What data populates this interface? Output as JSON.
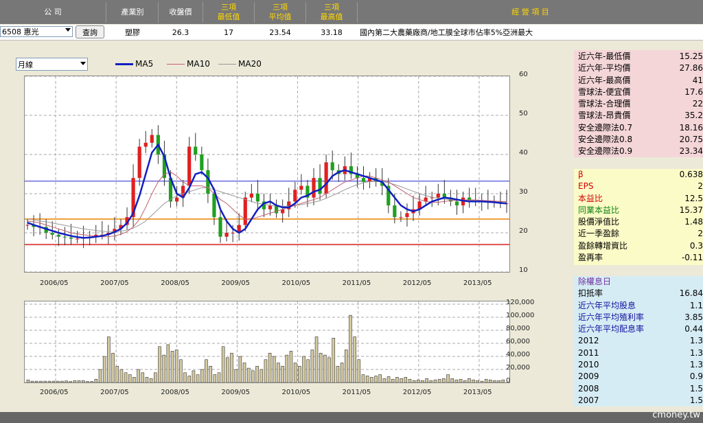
{
  "header": {
    "company": "公 司",
    "industry": "產業別",
    "close": "收盤價",
    "min3": [
      "三項",
      "最低值"
    ],
    "avg3": [
      "三項",
      "平均值"
    ],
    "max3": [
      "三項",
      "最高值"
    ],
    "business": "經 營 項 目"
  },
  "row": {
    "stock_code": "6508",
    "stock_name": "惠光",
    "query_button": "查詢",
    "industry": "塑膠",
    "close": "26.3",
    "min3": "17",
    "avg3": "23.54",
    "max3": "33.18",
    "business": "國內第二大農藥廠商/地工膜全球市佔率5%亞洲最大"
  },
  "period_select": "月線",
  "legend": [
    {
      "name": "MA5",
      "color": "#1020c0"
    },
    {
      "name": "MA10",
      "color": "#c06070"
    },
    {
      "name": "MA20",
      "color": "#999999"
    }
  ],
  "chart_data": [
    {
      "type": "candlestick",
      "x_ticks": [
        "2006/05",
        "2007/05",
        "2008/05",
        "2009/05",
        "2010/05",
        "2011/05",
        "2012/05",
        "2013/05"
      ],
      "y_ticks": [
        "60",
        "50",
        "40",
        "30",
        "20",
        "10"
      ],
      "ylim": [
        10,
        60
      ],
      "hlines": [
        {
          "value": 33.2,
          "color": "#8a8ae6"
        },
        {
          "value": 23.5,
          "color": "#f0a040"
        },
        {
          "value": 17,
          "color": "#e05050"
        }
      ],
      "closes": [
        22,
        21.5,
        21.5,
        20,
        19.5,
        19,
        18.8,
        18.5,
        18.5,
        18.8,
        19,
        19.5,
        19.5,
        20,
        21,
        22,
        24,
        34,
        42,
        43,
        45,
        40,
        34,
        28,
        29,
        32,
        42,
        40,
        36,
        30,
        24,
        19,
        20,
        20,
        22,
        29,
        30,
        28,
        26,
        27,
        25,
        26,
        28,
        31,
        32,
        29,
        34,
        30,
        38,
        36,
        35,
        37,
        35,
        34,
        33,
        34,
        33,
        32,
        27,
        24,
        24,
        25,
        26,
        28,
        29,
        29,
        30,
        29,
        28,
        27,
        29,
        28,
        28,
        28,
        28,
        28,
        27.5,
        27.5
      ],
      "ma5": [
        22.6,
        22,
        21.5,
        21,
        20.5,
        20,
        19.6,
        19.2,
        18.9,
        18.7,
        18.8,
        19,
        19.2,
        19.6,
        20.2,
        21,
        22.5,
        25,
        29.5,
        35,
        40.5,
        42.5,
        39.5,
        34,
        30,
        29,
        31.5,
        35,
        35.5,
        34,
        31,
        26,
        23,
        21,
        20,
        21,
        23.5,
        26,
        27.5,
        28,
        27,
        26.5,
        26.5,
        27.5,
        29,
        29.5,
        30.5,
        31,
        32.5,
        34.5,
        35.5,
        36,
        35.5,
        35,
        34.5,
        34,
        33.5,
        33,
        31,
        29,
        27,
        26,
        25.5,
        26,
        27,
        28,
        28.5,
        29,
        28.8,
        28.5,
        28.2,
        28,
        28,
        28,
        27.9,
        27.8,
        27.6,
        27.5
      ],
      "ma10": [
        23,
        22.8,
        22.5,
        22,
        21.5,
        21,
        20.5,
        20,
        19.7,
        19.5,
        19.3,
        19.1,
        19,
        19,
        19.2,
        19.6,
        20.3,
        21.5,
        23.5,
        26.5,
        30,
        33,
        35,
        35.5,
        34.5,
        33,
        32,
        32,
        32,
        31.5,
        30,
        28.5,
        27.5,
        26,
        24.5,
        23.5,
        23.5,
        24,
        24.5,
        25,
        25.5,
        26,
        26.5,
        27,
        27.5,
        28,
        28.5,
        29,
        30,
        31,
        32,
        33,
        33.5,
        34,
        34.5,
        34.5,
        34,
        33.5,
        33,
        32,
        31,
        30,
        29,
        28.5,
        28,
        27.8,
        27.8,
        28,
        28.2,
        28.3,
        28.4,
        28.4,
        28.4,
        28.3,
        28.2,
        28.1,
        28,
        27.9
      ],
      "ma20": [
        23.5,
        23.3,
        23,
        22.8,
        22.5,
        22.2,
        21.9,
        21.6,
        21.3,
        21,
        20.8,
        20.6,
        20.4,
        20.3,
        20.3,
        20.4,
        20.7,
        21.2,
        22,
        23,
        24.5,
        26,
        27.5,
        28.5,
        29.5,
        30,
        30.5,
        31,
        31.5,
        31.5,
        31,
        30.5,
        30,
        29.5,
        29,
        28.5,
        28,
        27.5,
        27.3,
        27,
        26.8,
        26.8,
        26.8,
        27,
        27.2,
        27.5,
        27.8,
        28.2,
        28.8,
        29.5,
        30.2,
        31,
        31.7,
        32.3,
        32.8,
        33.1,
        33.2,
        33.1,
        32.8,
        32.3,
        31.8,
        31.2,
        30.6,
        30,
        29.5,
        29.1,
        28.8,
        28.6,
        28.5,
        28.4,
        28.3,
        28.3,
        28.2,
        28.2,
        28.1,
        28.1,
        28,
        28
      ]
    },
    {
      "type": "bar",
      "x_ticks": [
        "2006/05",
        "2007/05",
        "2008/05",
        "2009/05",
        "2010/05",
        "2011/05",
        "2012/05",
        "2013/05"
      ],
      "y_ticks": [
        "120,000",
        "100,000",
        "80,000",
        "60,000",
        "40,000",
        "20,000",
        "0"
      ],
      "ylim": [
        0,
        120000
      ],
      "values": [
        4000,
        2000,
        2000,
        2000,
        2000,
        2000,
        2000,
        2000,
        2000,
        2500,
        1500,
        3000,
        3000,
        3000,
        1500,
        1500,
        5000,
        20000,
        40000,
        70000,
        45000,
        25000,
        20000,
        15000,
        12000,
        8000,
        20000,
        15000,
        8000,
        6000,
        15000,
        55000,
        42000,
        58000,
        48000,
        50000,
        35000,
        15000,
        10000,
        18000,
        12000,
        20000,
        35000,
        25000,
        12000,
        15000,
        55000,
        38000,
        45000,
        20000,
        40000,
        30000,
        22000,
        18000,
        25000,
        20000,
        35000,
        45000,
        40000,
        30000,
        25000,
        42000,
        48000,
        30000,
        25000,
        40000,
        35000,
        50000,
        70000,
        45000,
        42000,
        38000,
        68000,
        25000,
        30000,
        50000,
        103000,
        70000,
        35000,
        12000,
        10000,
        8000,
        10000,
        12000,
        6000,
        9000,
        5000,
        8000,
        6000,
        8000,
        5000,
        3000,
        4000,
        3000,
        6000,
        3000,
        4000,
        5000,
        6000,
        12000,
        6000,
        4000,
        5000,
        3000,
        6000,
        4000,
        3000,
        2000,
        5000,
        4000,
        3000,
        3000,
        4000
      ]
    }
  ],
  "sidebar": {
    "group1": [
      {
        "label": "近六年-最低價",
        "value": "15.25"
      },
      {
        "label": "近六年-平均價",
        "value": "27.86"
      },
      {
        "label": "近六年-最高價",
        "value": "41"
      },
      {
        "label": "雪球法-便宜價",
        "value": "17.6"
      },
      {
        "label": "雪球法-合理價",
        "value": "22"
      },
      {
        "label": "雪球法-昂貴價",
        "value": "35.2"
      },
      {
        "label": "安全邊際法0.7",
        "value": "18.16"
      },
      {
        "label": "安全邊際法0.8",
        "value": "20.75"
      },
      {
        "label": "安全邊際法0.9",
        "value": "23.34"
      }
    ],
    "group2": [
      {
        "label": "β",
        "value": "0.638",
        "color": "#d00000"
      },
      {
        "label": "EPS",
        "value": "2",
        "color": "#d00000"
      },
      {
        "label": "本益比",
        "value": "12.5",
        "color": "#d00000"
      },
      {
        "label": "同業本益比",
        "value": "15.37",
        "color": "#108010"
      },
      {
        "label": "股價淨值比",
        "value": "1.48",
        "color": "#000000"
      },
      {
        "label": "近一季盈餘",
        "value": "2",
        "color": "#000000"
      },
      {
        "label": "盈餘轉增資比",
        "value": "0.3",
        "color": "#000000"
      },
      {
        "label": "盈再率",
        "value": "-0.11",
        "color": "#000000"
      }
    ],
    "group3_title": "除權息日",
    "group3": [
      {
        "label": "扣抵率",
        "value": "16.84",
        "color": "#000000"
      },
      {
        "label": "近六年平均股息",
        "value": "1.1",
        "color": "#1010a0"
      },
      {
        "label": "近六年平均殖利率",
        "value": "3.85",
        "color": "#1010a0"
      },
      {
        "label": "近六年平均配息率",
        "value": "0.44",
        "color": "#1010a0"
      },
      {
        "label": "2012",
        "value": "1.3",
        "color": "#000000"
      },
      {
        "label": "2011",
        "value": "1.3",
        "color": "#000000"
      },
      {
        "label": "2010",
        "value": "1.3",
        "color": "#000000"
      },
      {
        "label": "2009",
        "value": "0.9",
        "color": "#000000"
      },
      {
        "label": "2008",
        "value": "1.5",
        "color": "#000000"
      },
      {
        "label": "2007",
        "value": "1.5",
        "color": "#000000"
      }
    ]
  },
  "watermark": "cmoney.tw"
}
